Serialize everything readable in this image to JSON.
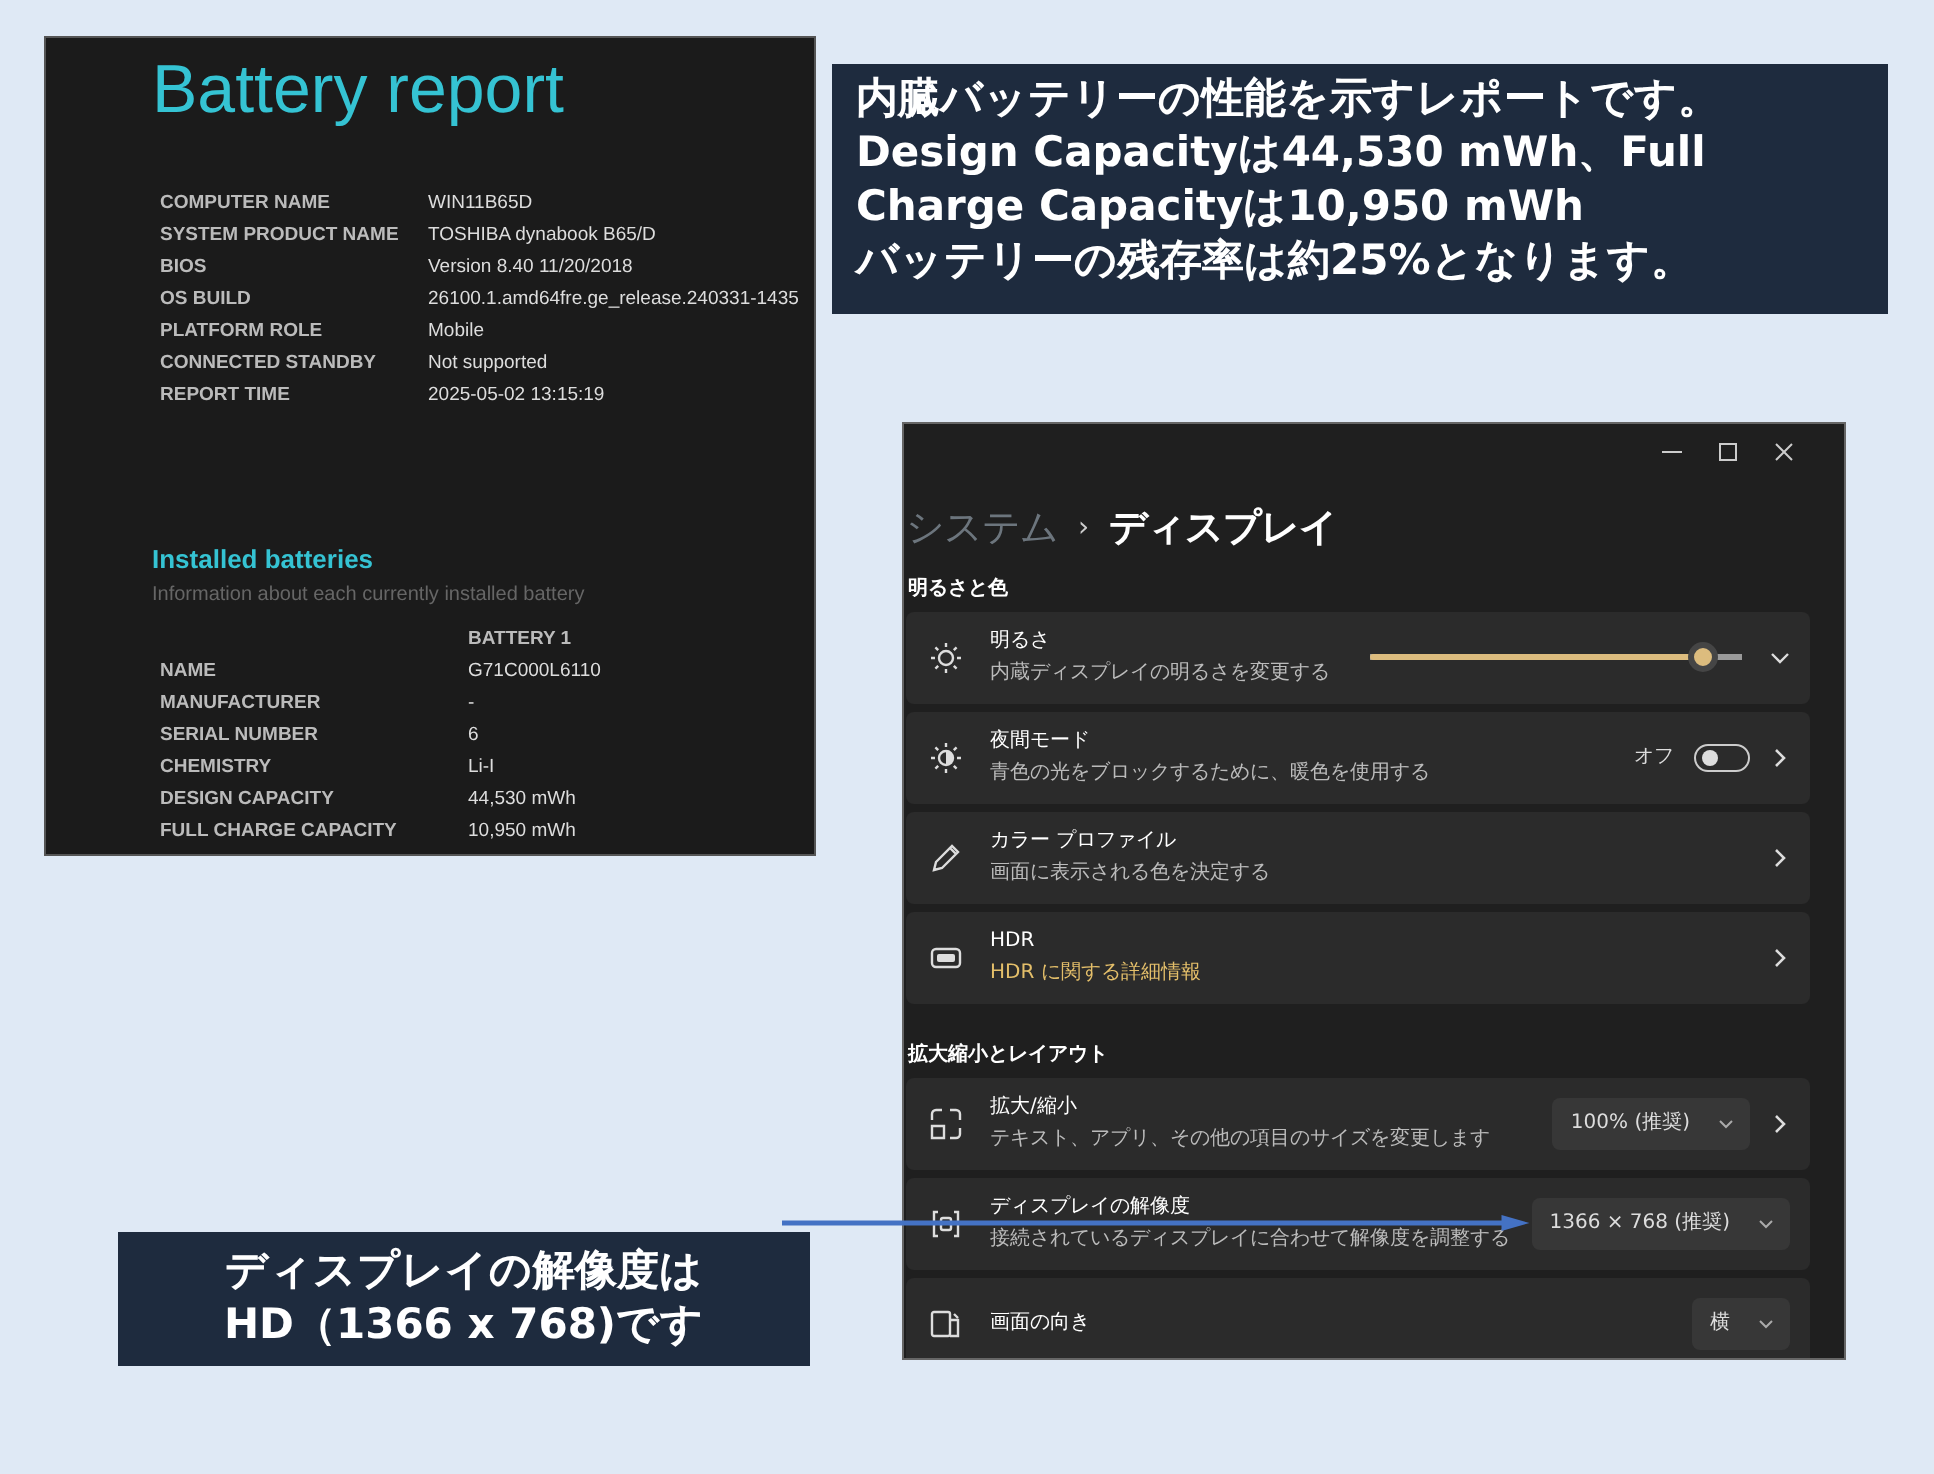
{
  "battery_report": {
    "title": "Battery report",
    "system_info": [
      {
        "label": "COMPUTER NAME",
        "value": "WIN11B65D"
      },
      {
        "label": "SYSTEM PRODUCT NAME",
        "value": "TOSHIBA dynabook B65/D"
      },
      {
        "label": "BIOS",
        "value": "Version 8.40 11/20/2018"
      },
      {
        "label": "OS BUILD",
        "value": "26100.1.amd64fre.ge_release.240331-1435"
      },
      {
        "label": "PLATFORM ROLE",
        "value": "Mobile"
      },
      {
        "label": "CONNECTED STANDBY",
        "value": "Not supported"
      },
      {
        "label": "REPORT TIME",
        "value": "2025-05-02  13:15:19"
      }
    ],
    "installed_batteries": {
      "title": "Installed batteries",
      "subtitle": "Information about each currently installed battery",
      "column_header": "BATTERY 1",
      "rows": [
        {
          "label": "NAME",
          "value": "G71C000L6110"
        },
        {
          "label": "MANUFACTURER",
          "value": "-"
        },
        {
          "label": "SERIAL NUMBER",
          "value": "6"
        },
        {
          "label": "CHEMISTRY",
          "value": "Li-I"
        },
        {
          "label": "DESIGN CAPACITY",
          "value": "44,530 mWh"
        },
        {
          "label": "FULL CHARGE CAPACITY",
          "value": "10,950 mWh"
        }
      ]
    }
  },
  "note": {
    "lines": [
      "内臓バッテリーの性能を示すレポートです。",
      "Design Capacityは44,530 mWh、Full",
      "Charge Capacityは10,950 mWh",
      "バッテリーの残存率は約25%となります。"
    ]
  },
  "settings_window": {
    "breadcrumb": {
      "parent": "システム",
      "separator": "›",
      "current": "ディスプレイ"
    },
    "sections": [
      {
        "title": "明るさと色",
        "items": [
          {
            "kind": "slider",
            "title": "明るさ",
            "description": "内蔵ディスプレイの明るさを変更する",
            "description_link": false,
            "level": 0.89
          },
          {
            "kind": "toggle",
            "title": "夜間モード",
            "description": "青色の光をブロックするために、暖色を使用する",
            "description_link": false,
            "state_label": "オフ",
            "on": false
          },
          {
            "kind": "link",
            "title": "カラー プロファイル",
            "description": "画面に表示される色を決定する",
            "description_link": false
          },
          {
            "kind": "link",
            "title": "HDR",
            "description": "HDR に関する詳細情報",
            "description_link": true
          }
        ]
      },
      {
        "title": "拡大縮小とレイアウト",
        "items": [
          {
            "kind": "dropdownlink",
            "title": "拡大/縮小",
            "description": "テキスト、アプリ、その他の項目のサイズを変更します",
            "description_link": false,
            "value": "100% (推奨)"
          },
          {
            "kind": "dropdown",
            "title": "ディスプレイの解像度",
            "description": "接続されているディスプレイに合わせて解像度を調整する",
            "description_link": false,
            "value": "1366 × 768 (推奨)"
          },
          {
            "kind": "dropdown",
            "title": "画面の向き",
            "value": "横"
          }
        ]
      }
    ]
  },
  "callout": {
    "lines": [
      "ディスプレイの解像度は",
      "HD（1366 x 768)です"
    ]
  }
}
